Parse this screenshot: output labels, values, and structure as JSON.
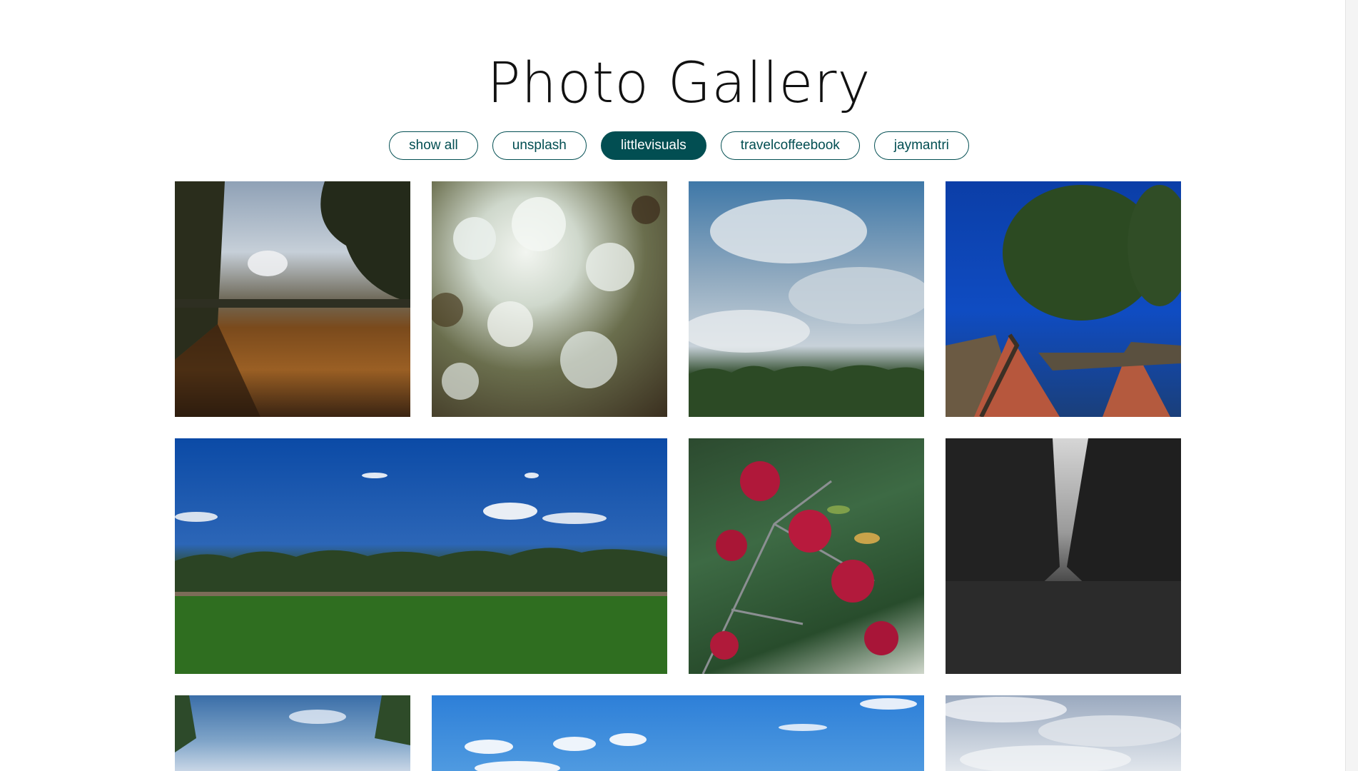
{
  "header": {
    "title": "Photo Gallery"
  },
  "filters": [
    {
      "label": "show all",
      "active": false
    },
    {
      "label": "unsplash",
      "active": false
    },
    {
      "label": "littlevisuals",
      "active": true
    },
    {
      "label": "travelcoffeebook",
      "active": false
    },
    {
      "label": "jaymantri",
      "active": false
    }
  ],
  "colors": {
    "accent": "#024e52",
    "background": "#ffffff"
  },
  "gallery": {
    "photos": [
      {
        "subject": "wheat field at dusk framed by trees"
      },
      {
        "subject": "blurred bokeh of leaves"
      },
      {
        "subject": "cloudy sky above treeline"
      },
      {
        "subject": "brick gabled roofs under tall trees"
      },
      {
        "subject": "green meadow with treeline and blue sky"
      },
      {
        "subject": "red rowan berries on branches"
      },
      {
        "subject": "black and white tree-lined avenue"
      },
      {
        "subject": "blue sky with trees"
      },
      {
        "subject": "blue sky with small clouds"
      },
      {
        "subject": "overcast cloudy sky"
      }
    ]
  }
}
